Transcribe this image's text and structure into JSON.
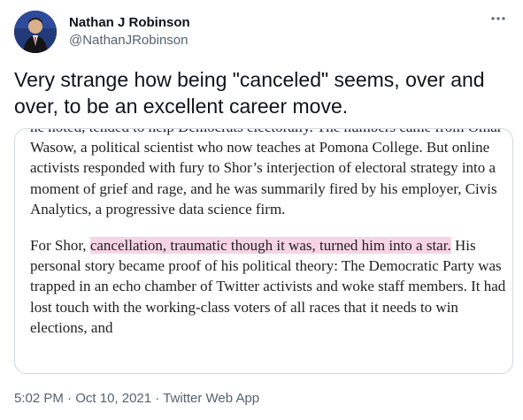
{
  "user": {
    "display_name": "Nathan J Robinson",
    "handle": "@NathanJRobinson"
  },
  "more_icon": "more-horizontal-icon",
  "tweet": {
    "text": "Very strange how being \"canceled\" seems, over and over, to be an excellent career move."
  },
  "article": {
    "p1_line0": "he noted, tended to help Democrats electorally. The numbers came",
    "p1_rest": "from Omar Wasow, a political scientist who now teaches at Pomona College. But online activists responded with fury to Shor’s interjection of electoral strategy into a moment of grief and rage, and he was summarily fired by his employer, Civis Analytics, a progressive data science firm.",
    "p2_before": "For Shor, ",
    "p2_highlight": "cancellation, traumatic though it was, turned him into a star.",
    "p2_after": " His personal story became proof of his political theory: The Democratic Party was trapped in an echo chamber of Twitter activists and woke staff members. It had lost touch with the working-class voters of all races that it needs to win elections, and"
  },
  "meta": {
    "time": "5:02 PM",
    "sep1": " · ",
    "date": "Oct 10, 2021",
    "sep2": " · ",
    "source": "Twitter Web App"
  },
  "colors": {
    "highlight": "#f6d4e6",
    "secondary_text": "#536471",
    "border": "#cfd9de"
  }
}
